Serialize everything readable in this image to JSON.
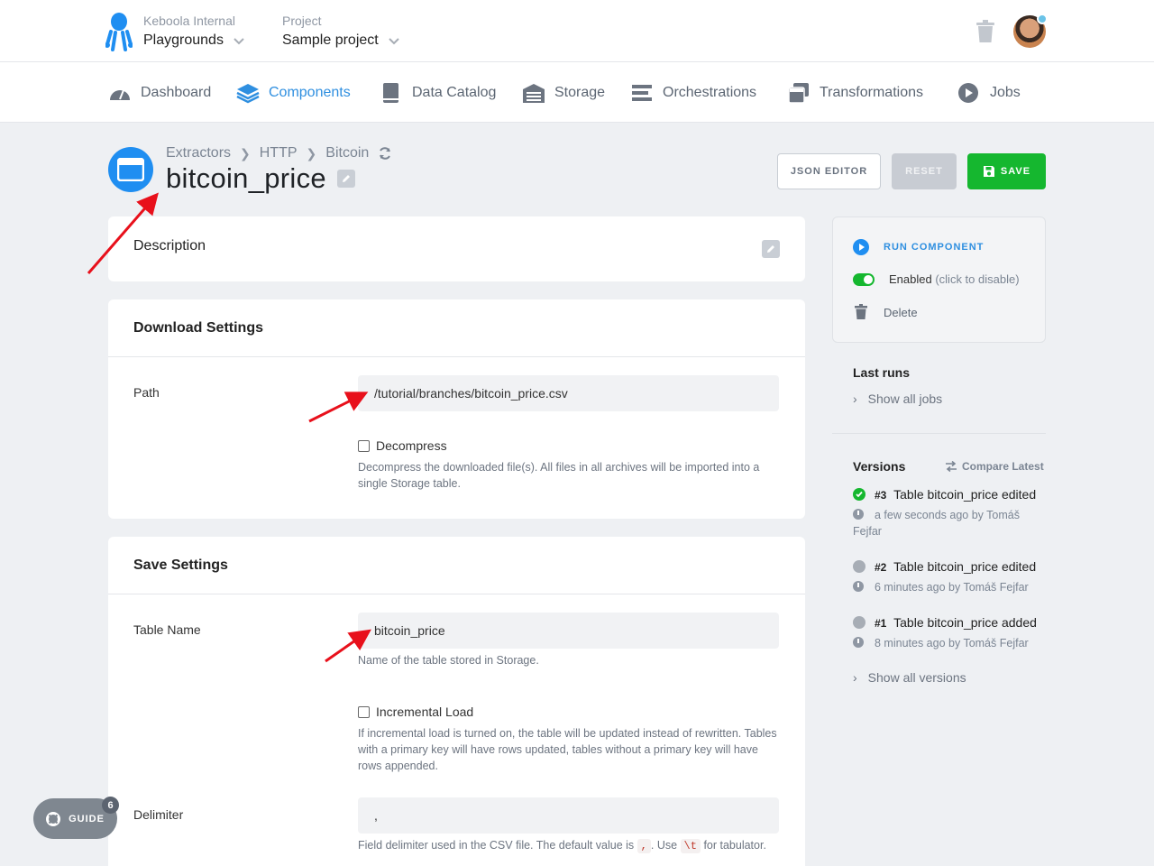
{
  "org": {
    "caption": "Keboola Internal",
    "name": "Playgrounds"
  },
  "project": {
    "caption": "Project",
    "name": "Sample project"
  },
  "nav": [
    {
      "label": "Dashboard",
      "icon": "dashboard-icon"
    },
    {
      "label": "Components",
      "icon": "layers-icon",
      "active": true
    },
    {
      "label": "Data Catalog",
      "icon": "book-icon"
    },
    {
      "label": "Storage",
      "icon": "warehouse-icon"
    },
    {
      "label": "Orchestrations",
      "icon": "bars-icon"
    },
    {
      "label": "Transformations",
      "icon": "window-stack-icon"
    },
    {
      "label": "Jobs",
      "icon": "play-circle-icon"
    }
  ],
  "breadcrumb": {
    "item1": "Extractors",
    "item2": "HTTP",
    "item3": "Bitcoin"
  },
  "title": "bitcoin_price",
  "actions": {
    "json_editor": "JSON EDITOR",
    "reset": "RESET",
    "save": "SAVE"
  },
  "description": {
    "title": "Description"
  },
  "download": {
    "title": "Download Settings",
    "path_label": "Path",
    "path_value": "/tutorial/branches/bitcoin_price.csv",
    "decompress_label": "Decompress",
    "decompress_help": "Decompress the downloaded file(s). All files in all archives will be imported into a single Storage table."
  },
  "save_settings": {
    "title": "Save Settings",
    "table_label": "Table Name",
    "table_value": "bitcoin_price",
    "table_help": "Name of the table stored in Storage.",
    "incremental_label": "Incremental Load",
    "incremental_help": "If incremental load is turned on, the table will be updated instead of rewritten. Tables with a primary key will have rows updated, tables without a primary key will have rows appended.",
    "delimiter_label": "Delimiter",
    "delimiter_value": ",",
    "delimiter_help_1": "Field delimiter used in the CSV file. The default value is",
    "delimiter_help_code1": ",",
    "delimiter_help_2": ". Use",
    "delimiter_help_code2": "\\t",
    "delimiter_help_3": "for tabulator."
  },
  "sidebar": {
    "run": "RUN COMPONENT",
    "enabled": "Enabled",
    "enabled_hint": "(click to disable)",
    "delete": "Delete",
    "last_runs": "Last runs",
    "show_all_jobs": "Show all jobs",
    "versions": "Versions",
    "compare": "Compare Latest",
    "show_all_versions": "Show all versions",
    "version_list": [
      {
        "num": "#3",
        "text": "Table bitcoin_price edited",
        "meta": "a few seconds ago by Tomáš Fejfar",
        "status": "success"
      },
      {
        "num": "#2",
        "text": "Table bitcoin_price edited",
        "meta": "6 minutes ago by Tomáš Fejfar",
        "status": "previous"
      },
      {
        "num": "#1",
        "text": "Table bitcoin_price added",
        "meta": "8 minutes ago by Tomáš Fejfar",
        "status": "previous"
      }
    ]
  },
  "guide": {
    "label": "GUIDE",
    "count": "6"
  },
  "colors": {
    "accent": "#2f8fe0",
    "success": "#15b72f",
    "annotation": "#e8101b"
  }
}
